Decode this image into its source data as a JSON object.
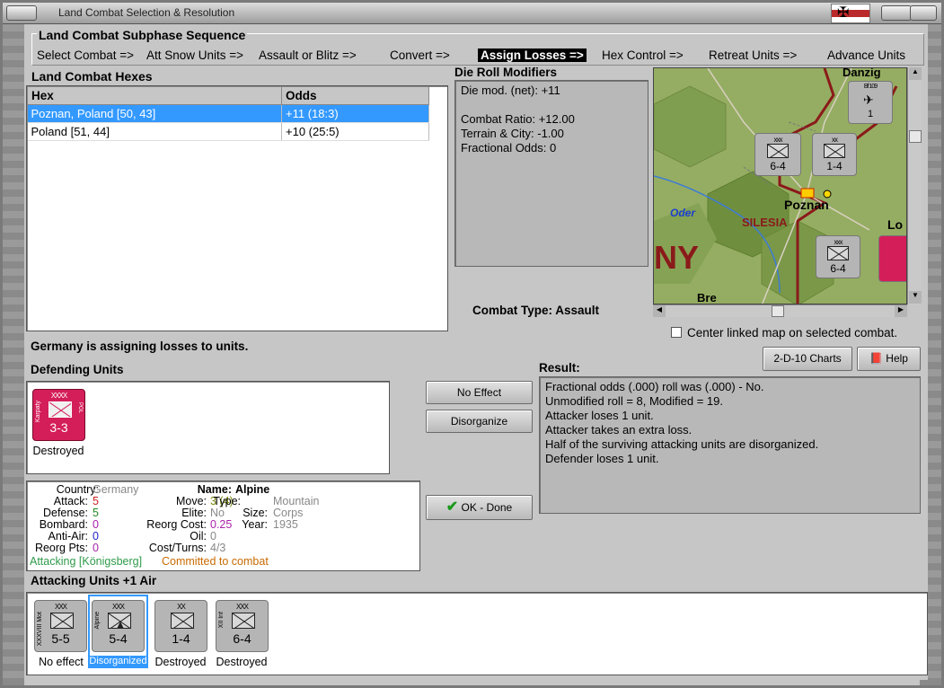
{
  "window": {
    "title": "Land Combat Selection & Resolution"
  },
  "subphase": {
    "title": "Land Combat Subphase Sequence",
    "steps": [
      "Select Combat =>",
      "Att Snow Units =>",
      "Assault or Blitz =>",
      "Convert =>",
      "Assign Losses =>",
      "Hex Control =>",
      "Retreat Units =>",
      "Advance Units"
    ],
    "active": "Assign Losses =>"
  },
  "hexes": {
    "title": "Land Combat Hexes",
    "columns": [
      "Hex",
      "Odds"
    ],
    "rows": [
      {
        "hex": "Poznan, Poland [50, 43]",
        "odds": "+11 (18:3)",
        "selected": true
      },
      {
        "hex": "Poland [51, 44]",
        "odds": "+10 (25:5)",
        "selected": false
      }
    ]
  },
  "die_roll": {
    "title": "Die Roll Modifiers",
    "lines": [
      "Die mod. (net): +11",
      "",
      "Combat Ratio: +12.00",
      "Terrain & City: -1.00",
      "Fractional Odds: 0"
    ]
  },
  "map": {
    "labels": {
      "city": "Poznan",
      "region": "SILESIA",
      "river": "Oder",
      "country_fragment": "NY",
      "north_city": "Danzig",
      "east_fragment": "Lo",
      "south_fragment": "Bre"
    },
    "units": [
      {
        "type": "xx",
        "str": "1-4"
      },
      {
        "type": "xxx",
        "str": "6-4"
      },
      {
        "type": "xxx",
        "str": "6-4"
      },
      {
        "type": "Bf 109",
        "str": "1"
      }
    ],
    "center_checkbox_label": "Center linked map on selected combat.",
    "center_checked": false
  },
  "combat_type": {
    "label": "Combat Type:",
    "value": "Assault"
  },
  "status_message": "Germany is assigning losses to units.",
  "defending": {
    "title": "Defending Units",
    "units": [
      {
        "size": "XXXX",
        "name": "Karpaty",
        "nation": "POL",
        "strength": "3-3",
        "status": "Destroyed",
        "color": "#d41e5a"
      }
    ]
  },
  "buttons": {
    "no_effect": "No Effect",
    "disorganize": "Disorganize",
    "ok_done": "OK - Done",
    "charts": "2-D-10 Charts",
    "help": "Help"
  },
  "result": {
    "title": "Result:",
    "lines": [
      "Fractional odds (.000) roll was (.000)  - No.",
      "Unmodified roll = 8, Modified = 19.",
      "Attacker loses 1 unit.",
      "Attacker takes an extra loss.",
      "Half of the surviving attacking units are disorganized.",
      "Defender loses 1 unit."
    ]
  },
  "unit_info": {
    "country_label": "Country:",
    "country": "Germany",
    "attack_label": "Attack:",
    "attack": "5",
    "defense_label": "Defense:",
    "defense": "5",
    "bombard_label": "Bombard:",
    "bombard": "0",
    "antiair_label": "Anti-Air:",
    "antiair": "0",
    "reorgpts_label": "Reorg Pts:",
    "reorgpts": "0",
    "name_label": "Name:",
    "name": "Alpine",
    "move_label": "Move:",
    "move": "3 (4)",
    "elite_label": "Elite:",
    "elite": "No",
    "reorgcost_label": "Reorg Cost:",
    "reorgcost": "0.25",
    "oil_label": "Oil:",
    "oil": "0",
    "costturns_label": "Cost/Turns:",
    "costturns": "4/3",
    "type_label": "Type:",
    "type": "Mountain",
    "size_label": "Size:",
    "size": "Corps",
    "year_label": "Year:",
    "year": "1935",
    "attacking_from": "Attacking [Königsberg]",
    "committed": "Committed to combat"
  },
  "attacking": {
    "title": "Attacking Units +1 Air",
    "units": [
      {
        "size": "XXX",
        "name": "XXXVIII Mot",
        "strength": "5-5",
        "status": "No effect",
        "highlight": false
      },
      {
        "size": "XXX",
        "name": "Alpine",
        "strength": "5-4",
        "status": "Disorganized",
        "highlight": true
      },
      {
        "size": "XX",
        "name": "",
        "strength": "1-4",
        "status": "Destroyed",
        "highlight": false
      },
      {
        "size": "XXX",
        "name": "XII Inf",
        "strength": "6-4",
        "status": "Destroyed",
        "highlight": false
      }
    ]
  },
  "colors": {
    "selection": "#3399ff",
    "attack": "#cc2222",
    "defense": "#228822",
    "bombard": "#aa22aa",
    "antiair": "#2222cc",
    "attacking_text": "#2f9a4a",
    "committed_text": "#c96a00",
    "defender_counter": "#d41e5a"
  }
}
